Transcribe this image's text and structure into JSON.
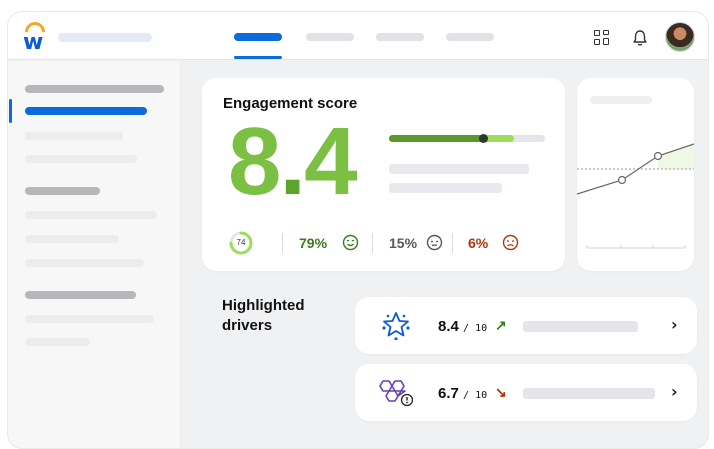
{
  "engagement": {
    "title": "Engagement score",
    "score": "8.4",
    "score_progress": 0.8,
    "ring_value": "74",
    "ring_fraction": 0.74,
    "favorable": {
      "value": "79%",
      "color": "#3a7d1d"
    },
    "neutral": {
      "value": "15%",
      "color": "#55595f"
    },
    "unfavorable": {
      "value": "6%",
      "color": "#b3340a"
    }
  },
  "drivers": {
    "title": "Highlighted drivers",
    "items": [
      {
        "score": "8.4",
        "of": "/ 10",
        "trend": "up",
        "arrow": "↗",
        "arrow_color": "#3a7d1d",
        "icon": "star-badge-icon"
      },
      {
        "score": "6.7",
        "of": "/ 10",
        "trend": "down",
        "arrow": "↘",
        "arrow_color": "#b3340a",
        "icon": "hexagon-warning-icon"
      }
    ]
  },
  "colors": {
    "accent": "#0a6bdc",
    "score_green": "#7cc043",
    "logo_orange": "#f5a623"
  },
  "icons": {
    "apps": "apps-grid-icon",
    "notifications": "bell-icon",
    "avatar": "user-avatar"
  }
}
